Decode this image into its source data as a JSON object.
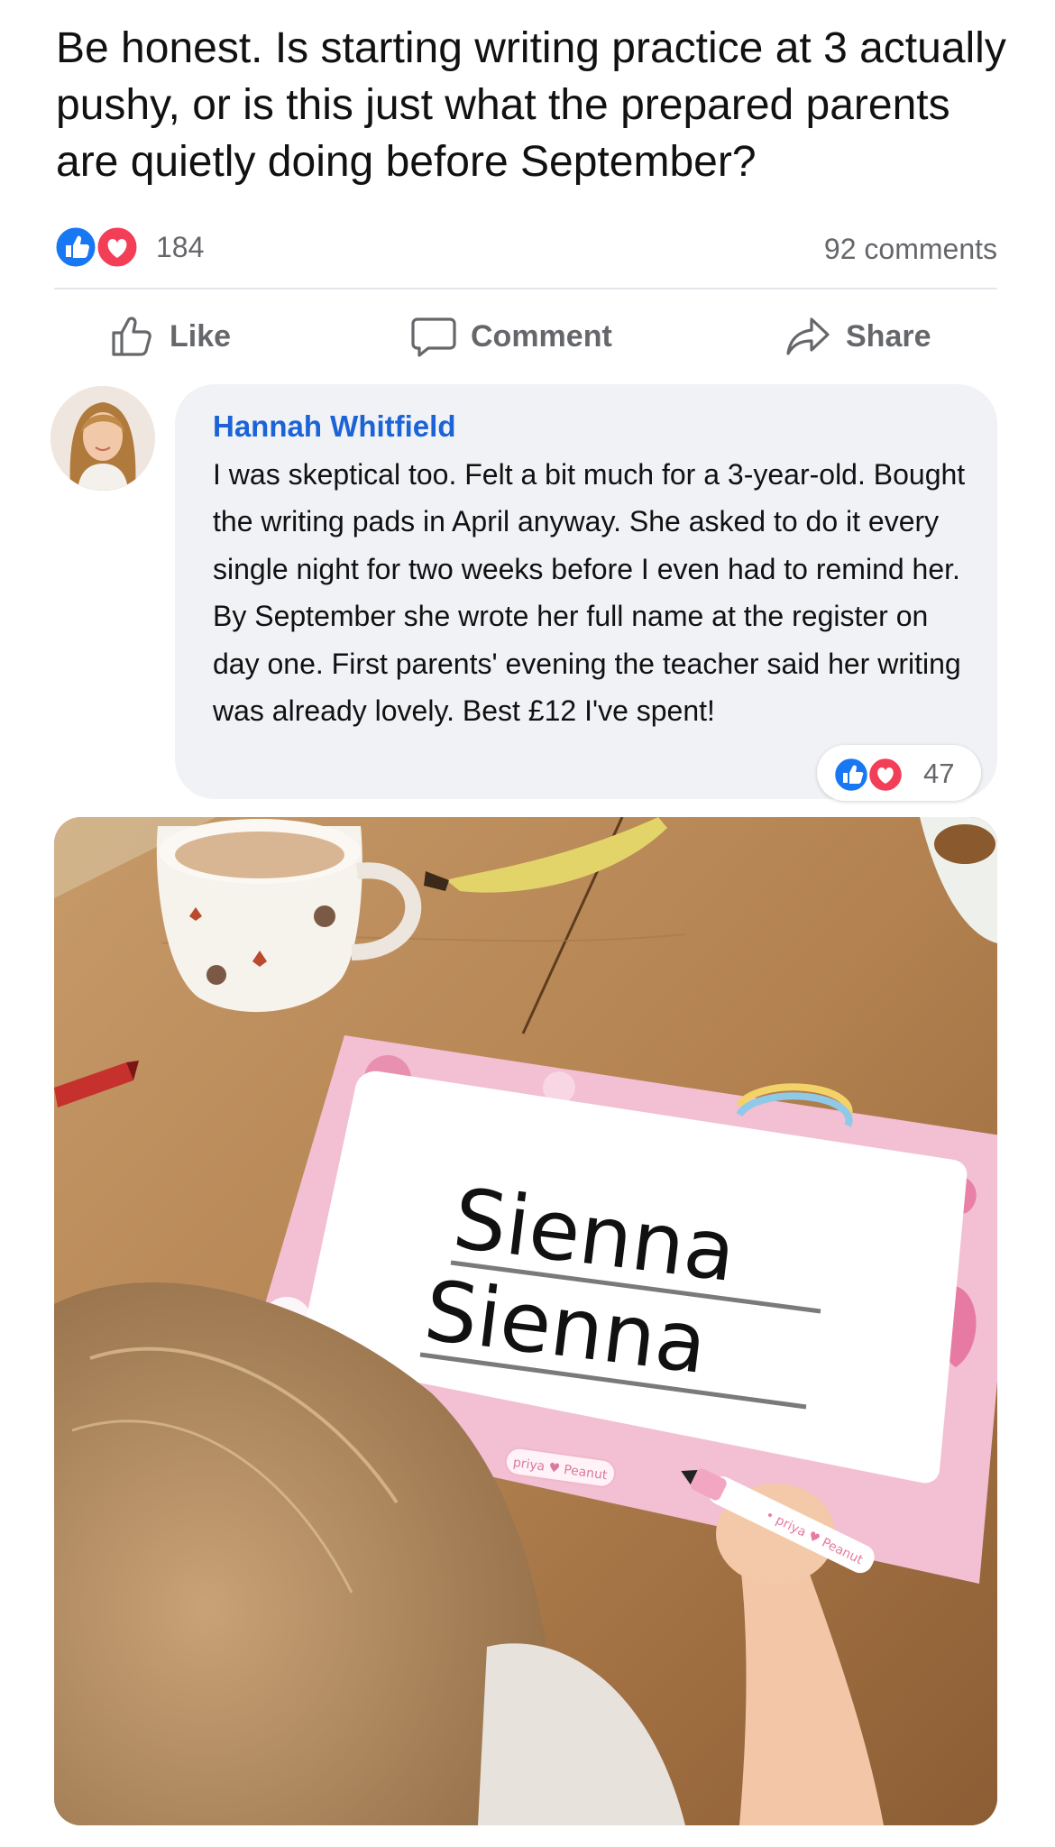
{
  "post": {
    "text": "Be honest. Is starting writing practice at 3 actually pushy, or is this just what the prepared parents are quietly doing before September?"
  },
  "stats": {
    "reaction_icons": [
      "like-icon",
      "heart-icon"
    ],
    "reaction_count": "184",
    "comments_count": "92 comments"
  },
  "actions": {
    "like_label": "Like",
    "comment_label": "Comment",
    "share_label": "Share"
  },
  "comment": {
    "author": "Hannah Whitfield",
    "text": "I was skeptical too. Felt a bit much for a 3-year-old. Bought the writing pads in April anyway. She asked to do it every single night for two weeks before I even had to remind her. By September she wrote her full name at the register on day one. First parents' evening the teacher said her writing was already lovely. Best £12 I've spent!",
    "reaction_icons": [
      "like-icon",
      "heart-icon"
    ],
    "reaction_count": "47"
  },
  "photo": {
    "traced_name_line1": "Sienna",
    "traced_name_line2": "Sienna",
    "pad_brand": "priya ♥ Peanut",
    "pen_brand": "• priya ♥ Peanut"
  },
  "colors": {
    "like_blue": "#1877f2",
    "heart_red": "#f33e58",
    "author_blue": "#1b63d6",
    "muted_text": "#65676b"
  }
}
